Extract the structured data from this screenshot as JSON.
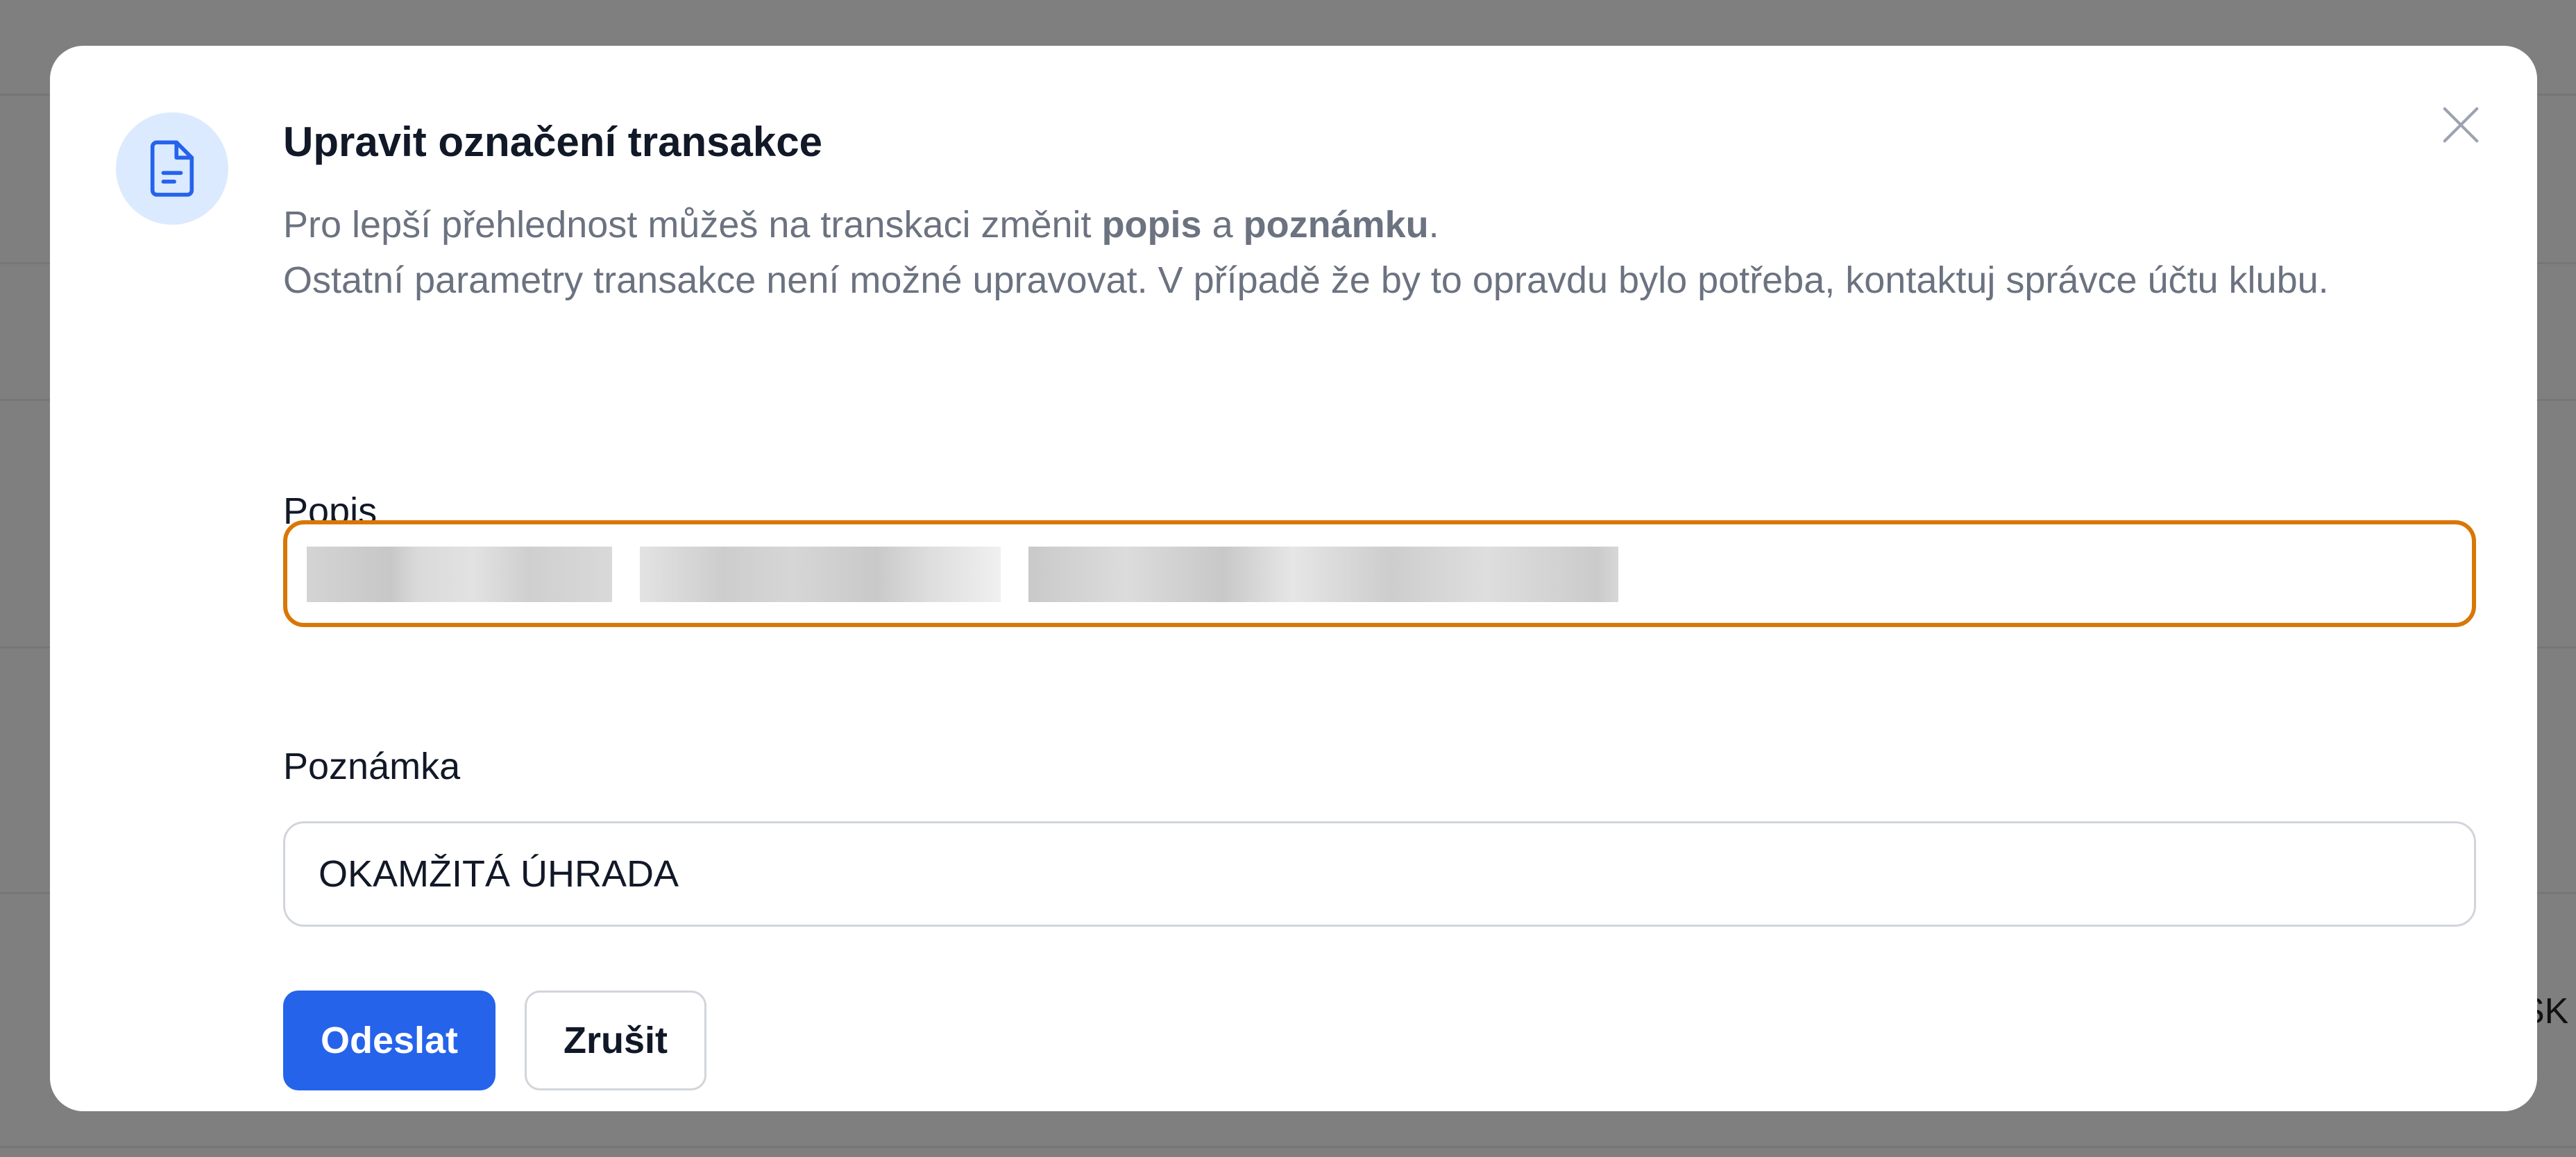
{
  "background": {
    "fragment_text": "SK"
  },
  "modal": {
    "icon": "document-icon",
    "title": "Upravit označení transakce",
    "description": {
      "line1_prefix": "Pro lepší přehlednost můžeš na transkaci změnit ",
      "line1_bold1": "popis",
      "line1_middle": " a ",
      "line1_bold2": "poznámku",
      "line1_suffix": ".",
      "line2": "Ostatní parametry transakce není možné upravovat. V případě že by to opravdu bylo potřeba, kontaktuj správce účtu klubu."
    },
    "fields": {
      "popis": {
        "label": "Popis",
        "value_redacted": true
      },
      "poznamka": {
        "label": "Poznámka",
        "value": "OKAMŽITÁ ÚHRADA"
      }
    },
    "buttons": {
      "submit": "Odeslat",
      "cancel": "Zrušit"
    },
    "close_icon": "close-icon"
  },
  "colors": {
    "primary": "#2563eb",
    "focus_border": "#d97706",
    "icon_bg": "#dbeafe",
    "overlay": "#7f7f7f"
  }
}
